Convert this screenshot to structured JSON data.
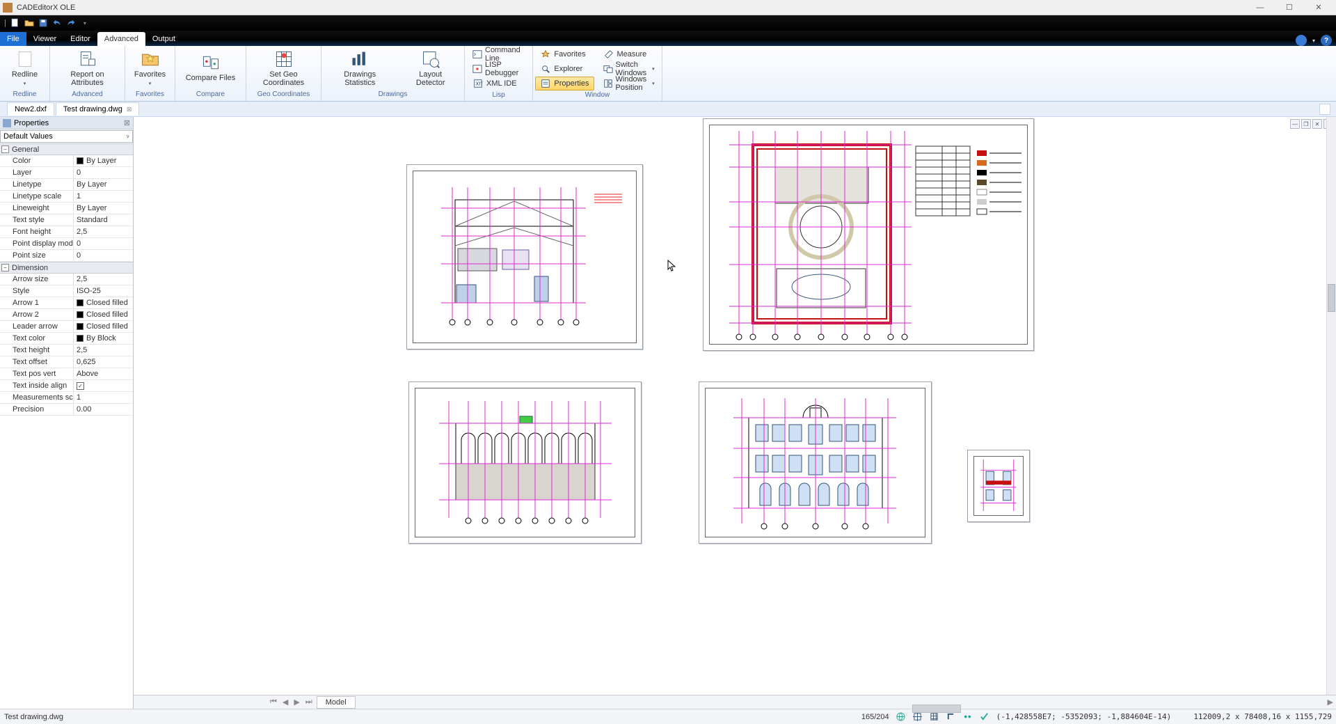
{
  "title": "CADEditorX OLE",
  "tabs": {
    "file": "File",
    "viewer": "Viewer",
    "editor": "Editor",
    "advanced": "Advanced",
    "output": "Output"
  },
  "ribbon": {
    "redline": {
      "btn": "Redline",
      "label": "Redline"
    },
    "advanced": {
      "report": "Report on Attributes",
      "label": "Advanced"
    },
    "favorites": {
      "btn": "Favorites",
      "label": "Favorites"
    },
    "compare": {
      "btn": "Compare Files",
      "label": "Compare"
    },
    "geo": {
      "btn": "Set Geo Coordinates",
      "label": "Geo Coordinates"
    },
    "drawings": {
      "stats": "Drawings Statistics",
      "layout": "Layout Detector",
      "label": "Drawings"
    },
    "lisp": {
      "cmd": "Command Line",
      "dbg": "LISP Debugger",
      "ide": "XML IDE",
      "label": "Lisp"
    },
    "window": {
      "fav": "Favorites",
      "exp": "Explorer",
      "prop": "Properties",
      "meas": "Measure",
      "sw": "Switch Windows",
      "pos": "Windows Position",
      "label": "Window"
    }
  },
  "docTabs": {
    "t1": "New2.dxf",
    "t2": "Test drawing.dwg"
  },
  "props": {
    "title": "Properties",
    "selector": "Default Values",
    "groups": {
      "general": {
        "title": "General",
        "rows": [
          {
            "n": "Color",
            "v": "By Layer",
            "sw": true
          },
          {
            "n": "Layer",
            "v": "0"
          },
          {
            "n": "Linetype",
            "v": "By Layer"
          },
          {
            "n": "Linetype scale",
            "v": "1"
          },
          {
            "n": "Lineweight",
            "v": "By Layer"
          },
          {
            "n": "Text style",
            "v": "Standard"
          },
          {
            "n": "Font height",
            "v": "2,5"
          },
          {
            "n": "Point display mode",
            "v": "0"
          },
          {
            "n": "Point size",
            "v": "0"
          }
        ]
      },
      "dimension": {
        "title": "Dimension",
        "rows": [
          {
            "n": "Arrow size",
            "v": "2,5"
          },
          {
            "n": "Style",
            "v": "ISO-25"
          },
          {
            "n": "Arrow 1",
            "v": "Closed filled",
            "sw": true
          },
          {
            "n": "Arrow 2",
            "v": "Closed filled",
            "sw": true
          },
          {
            "n": "Leader arrow",
            "v": "Closed filled",
            "sw": true
          },
          {
            "n": "Text color",
            "v": "By Block",
            "sw": true
          },
          {
            "n": "Text height",
            "v": "2,5"
          },
          {
            "n": "Text offset",
            "v": "0,625"
          },
          {
            "n": "Text pos vert",
            "v": "Above"
          },
          {
            "n": "Text inside align",
            "v": "",
            "chk": true
          },
          {
            "n": "Measurements scale",
            "v": "1"
          },
          {
            "n": "Precision",
            "v": "0.00"
          }
        ]
      }
    }
  },
  "modelTab": "Model",
  "status": {
    "file": "Test drawing.dwg",
    "page": "165/204",
    "coords": "(-1,428558E7; -5352093; -1,884604E-14)",
    "dims": "112009,2 x 78408,16 x 1155,729"
  }
}
